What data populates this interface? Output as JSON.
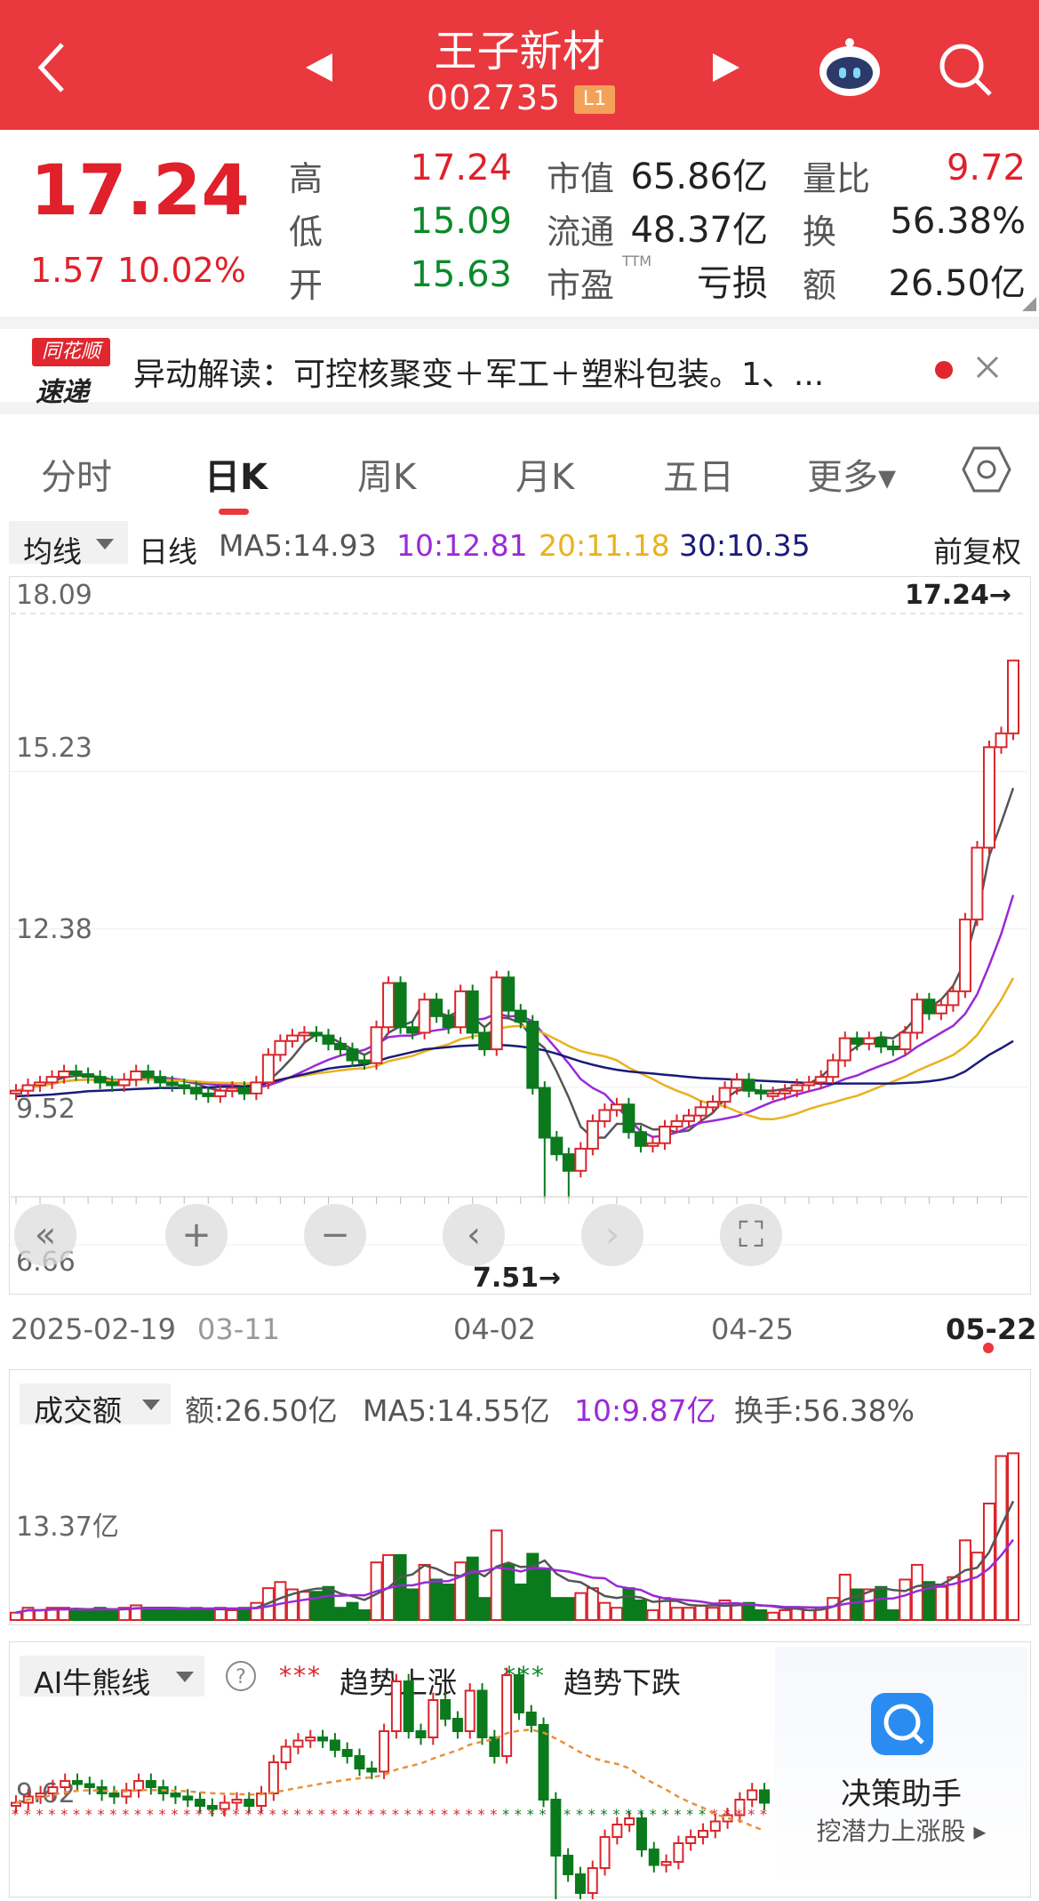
{
  "header": {
    "name": "王子新材",
    "code": "002735",
    "level": "L1"
  },
  "quote": {
    "price": "17.24",
    "change": "1.57",
    "change_pct": "10.02%",
    "rows": [
      [
        {
          "label": "高",
          "value": "17.24",
          "color": "red"
        },
        {
          "label": "市值",
          "value": "65.86亿",
          "color": "dark"
        },
        {
          "label": "量比",
          "value": "9.72",
          "color": "red"
        }
      ],
      [
        {
          "label": "低",
          "value": "15.09",
          "color": "green"
        },
        {
          "label": "流通",
          "value": "48.37亿",
          "color": "dark"
        },
        {
          "label": "换",
          "value": "56.38%",
          "color": "dark"
        }
      ],
      [
        {
          "label": "开",
          "value": "15.63",
          "color": "green"
        },
        {
          "label": "市盈",
          "sup": "TTM",
          "value": "亏损",
          "color": "dark"
        },
        {
          "label": "额",
          "value": "26.50亿",
          "color": "dark"
        }
      ]
    ]
  },
  "news": {
    "logo_top": "同花顺",
    "logo_bottom": "速递",
    "text": "异动解读：可控核聚变＋军工＋塑料包装。1、..."
  },
  "tabs": [
    {
      "label": "分时",
      "active": false
    },
    {
      "label": "日K",
      "active": true
    },
    {
      "label": "周K",
      "active": false
    },
    {
      "label": "月K",
      "active": false
    },
    {
      "label": "五日",
      "active": false
    },
    {
      "label": "更多▾",
      "active": false
    }
  ],
  "kline": {
    "selector": "均线",
    "period": "日线",
    "ma5": "MA5:14.93",
    "ma10": "10:12.81",
    "ma20": "20:11.18",
    "ma30": "30:10.35",
    "adjust": "前复权",
    "y_ticks": [
      "18.09",
      "15.23",
      "12.38",
      "9.52",
      "6.66"
    ],
    "x_ticks": [
      "2025-02-19",
      "03-11",
      "04-02",
      "04-25",
      "05-22"
    ],
    "high_marker": "17.24→",
    "low_marker": "7.51→",
    "colors": {
      "up": "#d9262c",
      "down": "#0a7a1c",
      "ma5": "#555555",
      "ma10": "#9a2ad6",
      "ma20": "#e8b21e",
      "ma30": "#1a1a7a"
    }
  },
  "turnover": {
    "selector": "成交额",
    "amount": "额:26.50亿",
    "ma5": "MA5:14.55亿",
    "ma10": "10:9.87亿",
    "turnover_rate": "换手:56.38%",
    "y_tick": "13.37亿"
  },
  "ai": {
    "selector": "AI牛熊线",
    "rise": "趋势上涨",
    "fall": "趋势下跌",
    "y_tick": "9.62",
    "assistant_title": "决策助手",
    "assistant_sub": "挖潜力上涨股 ▸"
  },
  "chart_data": {
    "type": "candlestick",
    "x_range": [
      "2025-02-19",
      "05-22"
    ],
    "ylim": [
      6.66,
      18.09
    ],
    "high": 17.24,
    "low": 7.51,
    "close": [
      9.45,
      9.55,
      9.6,
      9.7,
      9.8,
      9.75,
      9.7,
      9.6,
      9.55,
      9.65,
      9.8,
      9.7,
      9.6,
      9.55,
      9.5,
      9.4,
      9.35,
      9.45,
      9.5,
      9.4,
      9.6,
      10.1,
      10.35,
      10.45,
      10.5,
      10.45,
      10.3,
      10.2,
      10.0,
      9.95,
      10.6,
      11.4,
      10.6,
      10.5,
      11.1,
      10.8,
      10.6,
      11.25,
      10.5,
      10.2,
      11.5,
      10.9,
      10.7,
      9.5,
      8.6,
      8.3,
      8.0,
      8.4,
      8.9,
      9.1,
      9.2,
      8.7,
      8.45,
      8.5,
      8.8,
      8.9,
      9.0,
      9.15,
      9.25,
      9.5,
      9.65,
      9.45,
      9.4,
      9.4,
      9.45,
      9.55,
      9.6,
      9.7,
      10.0,
      10.4,
      10.3,
      10.4,
      10.25,
      10.2,
      10.5,
      11.1,
      10.85,
      11.0,
      11.25,
      12.55,
      13.85,
      15.67,
      15.92,
      17.24
    ],
    "ma5": [
      9.45,
      9.5,
      9.55,
      9.62,
      9.69,
      9.72,
      9.72,
      9.7,
      9.65,
      9.64,
      9.66,
      9.68,
      9.68,
      9.66,
      9.62,
      9.58,
      9.5,
      9.45,
      9.45,
      9.44,
      9.46,
      9.62,
      9.82,
      10.05,
      10.32,
      10.47,
      10.43,
      10.32,
      10.2,
      10.1,
      10.21,
      10.5,
      10.62,
      10.7,
      11.08,
      10.88,
      10.8,
      10.9,
      10.78,
      10.6,
      10.78,
      10.76,
      10.68,
      10.4,
      10.22,
      9.8,
      9.33,
      8.8,
      8.6,
      8.6,
      8.85,
      8.85,
      8.85,
      8.75,
      8.75,
      8.7,
      8.73,
      8.9,
      9.05,
      9.3,
      9.45,
      9.48,
      9.45,
      9.45,
      9.48,
      9.52,
      9.58,
      9.7,
      9.9,
      10.1,
      10.25,
      10.38,
      10.42,
      10.4,
      10.55,
      10.8,
      10.95,
      11.1,
      11.35,
      11.8,
      12.6,
      13.7,
      14.3,
      14.93
    ],
    "ma30": [
      9.35,
      9.36,
      9.37,
      9.38,
      9.4,
      9.42,
      9.44,
      9.45,
      9.46,
      9.47,
      9.48,
      9.49,
      9.5,
      9.5,
      9.5,
      9.5,
      9.51,
      9.52,
      9.52,
      9.53,
      9.55,
      9.6,
      9.65,
      9.7,
      9.75,
      9.8,
      9.85,
      9.88,
      9.9,
      9.92,
      9.98,
      10.05,
      10.1,
      10.15,
      10.2,
      10.22,
      10.24,
      10.26,
      10.27,
      10.28,
      10.28,
      10.27,
      10.25,
      10.22,
      10.18,
      10.12,
      10.05,
      9.98,
      9.92,
      9.87,
      9.83,
      9.8,
      9.78,
      9.76,
      9.74,
      9.72,
      9.7,
      9.68,
      9.67,
      9.66,
      9.65,
      9.64,
      9.63,
      9.62,
      9.61,
      9.6,
      9.59,
      9.58,
      9.58,
      9.58,
      9.58,
      9.58,
      9.58,
      9.58,
      9.59,
      9.6,
      9.62,
      9.65,
      9.7,
      9.8,
      9.95,
      10.1,
      10.22,
      10.35
    ]
  }
}
